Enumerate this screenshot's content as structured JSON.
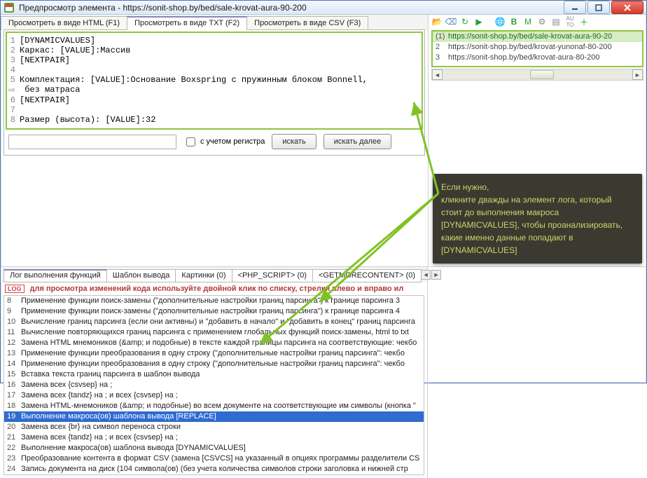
{
  "window": {
    "title": "Предпросмотр элемента - https://sonit-shop.by/bed/sale-krovat-aura-90-200"
  },
  "toptabs": {
    "items": [
      {
        "label": "Просмотреть в виде HTML (F1)"
      },
      {
        "label": "Просмотреть в виде TXT (F2)"
      },
      {
        "label": "Просмотреть в виде CSV (F3)"
      }
    ],
    "active": 1
  },
  "code": {
    "lines": [
      {
        "n": "1",
        "t": "[DYNAMICVALUES]"
      },
      {
        "n": "2",
        "t": "Каркас: [VALUE]:Массив"
      },
      {
        "n": "3",
        "t": "[NEXTPAIR]"
      },
      {
        "n": "4",
        "t": ""
      },
      {
        "n": "5",
        "t": "Комплектация: [VALUE]:Основание Boxspring с пружинным блоком Bonnell,"
      },
      {
        "n": "⇨",
        "t": " без матраса"
      },
      {
        "n": "6",
        "t": "[NEXTPAIR]"
      },
      {
        "n": "7",
        "t": ""
      },
      {
        "n": "8",
        "t": "Размер (высота): [VALUE]:32"
      }
    ]
  },
  "search": {
    "case_label": "с учетом регистра",
    "find_label": "искать",
    "find_next_label": "искать далее"
  },
  "urls": {
    "items": [
      {
        "n": "(1)",
        "t": "https://sonit-shop.by/bed/sale-krovat-aura-90-20",
        "sel": true
      },
      {
        "n": "2",
        "t": "https://sonit-shop.by/bed/krovat-yunonaf-80-200",
        "sel": false
      },
      {
        "n": "3",
        "t": "https://sonit-shop.by/bed/krovat-aura-80-200",
        "sel": false
      }
    ]
  },
  "tooltip": {
    "text": "Если нужно,\nкликните дважды на элемент лога, который стоит до выполнения макроса [DYNAMICVALUES], чтобы проанализировать, какие именно данные попадают в [DYNAMICVALUES]"
  },
  "logtabs": {
    "items": [
      {
        "label": "Лог выполнения функций"
      },
      {
        "label": "Шаблон вывода"
      },
      {
        "label": "Картинки (0)"
      },
      {
        "label": "<PHP_SCRIPT> (0)"
      },
      {
        "label": "<GETMORECONTENT> (0)"
      }
    ],
    "active": 0
  },
  "log_hint": {
    "badge": "LOG",
    "text": "для просмотра изменений кода используйте двойной клик по списку, стрелки влево и вправо ил"
  },
  "log": {
    "items": [
      {
        "n": "8",
        "t": "Применение функции поиск-замены (\"дополнительные настройки границ парсинга\") к границе парсинга 3",
        "sel": false
      },
      {
        "n": "9",
        "t": "Применение функции поиск-замены (\"дополнительные настройки границ парсинга\") к границе парсинга 4",
        "sel": false
      },
      {
        "n": "10",
        "t": "Вычисление границ парсинга (если они активны) и \"добавить в начало\" и \"добавить в конец\" границ парсинга",
        "sel": false
      },
      {
        "n": "11",
        "t": "Вычисление повторяющихся границ парсинга с применением глобальных функций поиск-замены, html to txt",
        "sel": false
      },
      {
        "n": "12",
        "t": "Замена HTML мнемоников (&amp; и подобные) в тексте каждой границы парсинга на соответствующие: чекбо",
        "sel": false
      },
      {
        "n": "13",
        "t": "Применение функции преобразования в одну строку (\"дополнительные настройки границ парсинга\": чекбо",
        "sel": false
      },
      {
        "n": "14",
        "t": "Применение функции преобразования в одну строку (\"дополнительные настройки границ парсинга\": чекбо",
        "sel": false
      },
      {
        "n": "15",
        "t": "Вставка текста границ парсинга в шаблон вывода",
        "sel": false
      },
      {
        "n": "16",
        "t": "Замена всех {csvsep} на ;",
        "sel": false
      },
      {
        "n": "17",
        "t": "Замена всех {tandz} на ; и всех {csvsep} на ;",
        "sel": false
      },
      {
        "n": "18",
        "t": "Замена HTML-мнемоников (&amp; и подобные) во всем документе на соответствующие им символы (кнопка \"",
        "sel": false
      },
      {
        "n": "19",
        "t": "Выполнение макроса(ов) шаблона вывода [REPLACE]",
        "sel": true
      },
      {
        "n": "20",
        "t": "Замена всех {br} на символ переноса строки",
        "sel": false
      },
      {
        "n": "21",
        "t": "Замена всех {tandz} на ; и всех {csvsep} на ;",
        "sel": false
      },
      {
        "n": "22",
        "t": "Выполнение макроса(ов) шаблона вывода [DYNAMICVALUES]",
        "sel": false
      },
      {
        "n": "23",
        "t": "Преобразование контента в формат CSV (замена [CSVCS] на указанный в опциях программы разделители CS",
        "sel": false
      },
      {
        "n": "24",
        "t": "Запись документа на диск (104 символа(ов) (без учета количества символов строки заголовка и нижней стр",
        "sel": false
      }
    ]
  }
}
